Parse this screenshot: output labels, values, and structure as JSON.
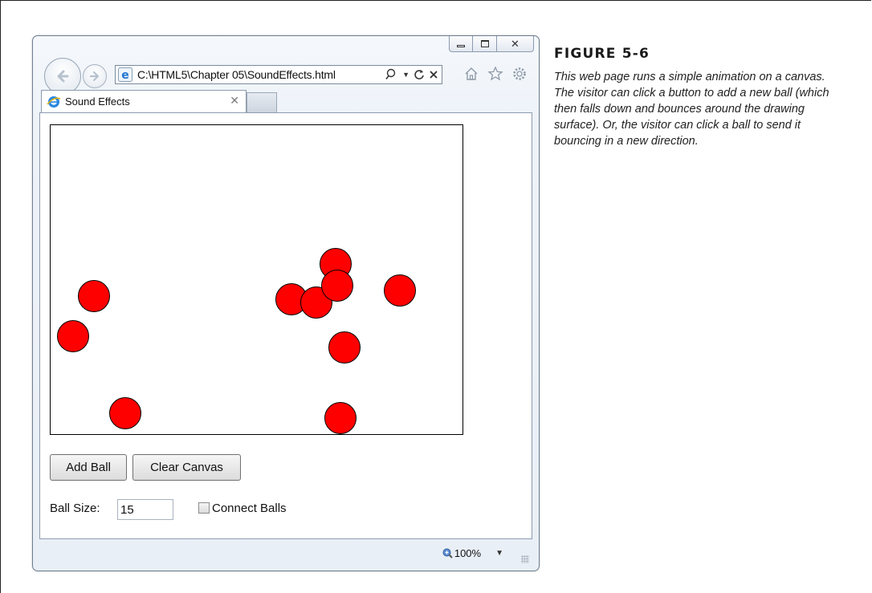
{
  "browser": {
    "address": "C:\\HTML5\\Chapter 05\\SoundEffects.html",
    "tab_title": "Sound Effects",
    "zoom": "100%"
  },
  "page": {
    "add_ball_label": "Add Ball",
    "clear_canvas_label": "Clear Canvas",
    "ball_size_label": "Ball Size:",
    "ball_size_value": "15",
    "connect_balls_label": "Connect Balls",
    "connect_balls_checked": false,
    "ball_count": 11,
    "ball_color": "#ff0000"
  },
  "figure": {
    "title": "FIGURE 5-6",
    "caption": "This web page runs a simple animation on a canvas. The visitor can click a button to add a new ball (which then falls down and bounces around the drawing surface). Or, the visitor can click a ball to send it bouncing in a new direction."
  },
  "icons": [
    "back-icon",
    "forward-icon",
    "ie-icon",
    "search-icon",
    "refresh-icon",
    "stop-icon",
    "home-icon",
    "favorites-icon",
    "tools-icon",
    "zoom-icon"
  ]
}
